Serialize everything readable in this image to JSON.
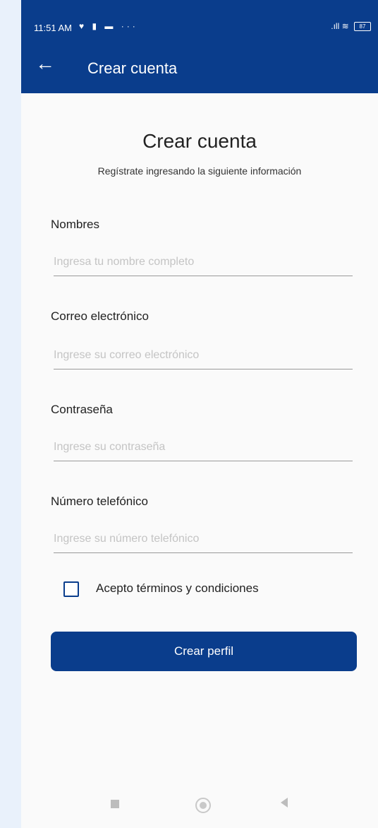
{
  "status_bar": {
    "time": "11:51 AM",
    "icons_left": "♥ ▮ ▬ ···",
    "signal": ".ıll",
    "wifi": "wifi",
    "battery": "87"
  },
  "app_bar": {
    "back_icon": "←",
    "title": "Crear cuenta"
  },
  "form": {
    "title": "Crear cuenta",
    "subtitle": "Regístrate ingresando la siguiente información",
    "fields": [
      {
        "label": "Nombres",
        "placeholder": "Ingresa tu nombre completo",
        "value": ""
      },
      {
        "label": "Correo electrónico",
        "placeholder": "Ingrese su correo electrónico",
        "value": ""
      },
      {
        "label": "Contraseña",
        "placeholder": "Ingrese su contraseña",
        "value": ""
      },
      {
        "label": "Número telefónico",
        "placeholder": "Ingrese su número telefónico",
        "value": ""
      }
    ],
    "terms_label": "Acepto términos y condiciones",
    "terms_checked": false,
    "submit_label": "Crear perfil"
  },
  "colors": {
    "primary": "#0a3d8c",
    "background": "#fafafa"
  },
  "icons": {
    "back": "arrow-left-icon",
    "nav_recent": "square-icon",
    "nav_home": "circle-icon",
    "nav_back": "triangle-left-icon"
  }
}
